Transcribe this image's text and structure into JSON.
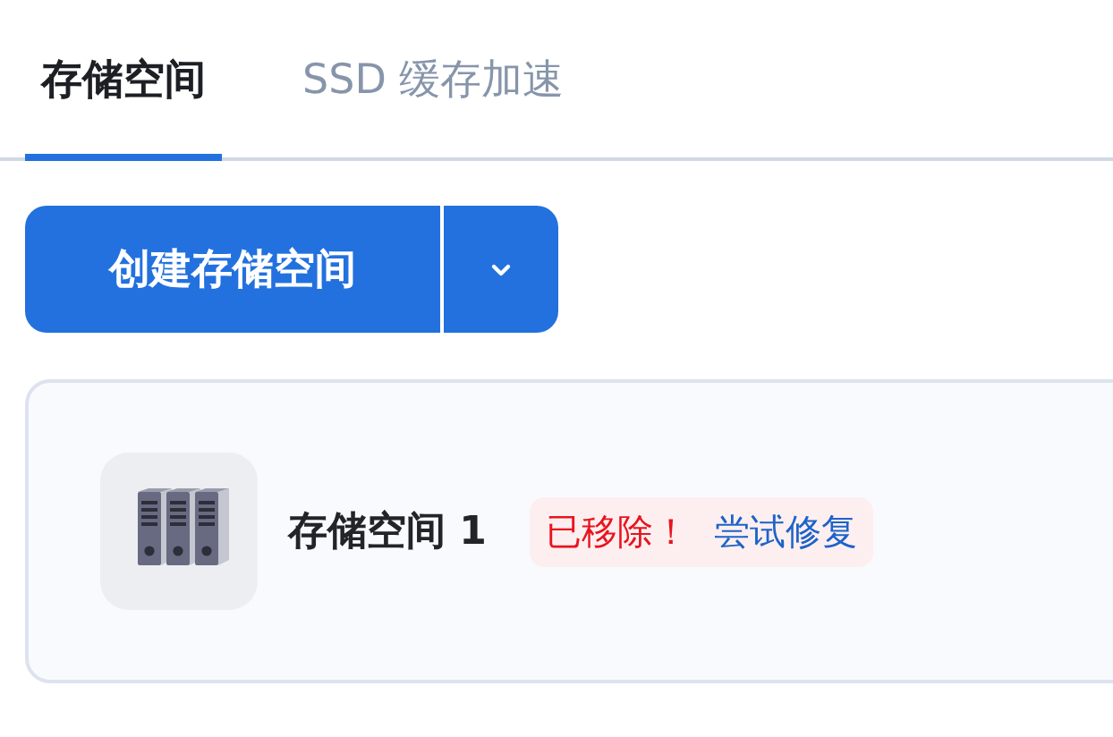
{
  "tabs": [
    {
      "label": "存储空间",
      "selected": true
    },
    {
      "label": "SSD 缓存加速",
      "selected": false
    }
  ],
  "create_button": {
    "label": "创建存储空间"
  },
  "pools": [
    {
      "name": "存储空间 1",
      "status": "已移除！",
      "action": "尝试修复"
    }
  ]
}
